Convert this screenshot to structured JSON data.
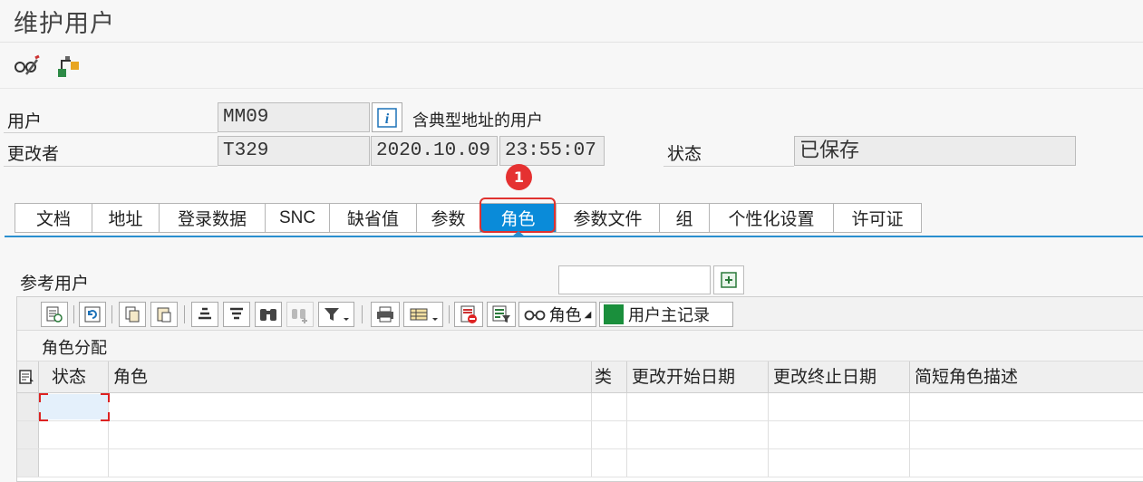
{
  "window": {
    "title": "维护用户"
  },
  "toolbar": {
    "icons": [
      "glasses-pen-icon",
      "hierarchy-icon"
    ]
  },
  "header": {
    "user_label": "用户",
    "user_value": "MM09",
    "user_desc": "含典型地址的用户",
    "changed_by_label": "更改者",
    "changed_by_value": "T329",
    "date": "2020.10.09",
    "time": "23:55:07",
    "status_label": "状态",
    "status_value": "已保存"
  },
  "tabs": [
    {
      "label": "文档"
    },
    {
      "label": "地址"
    },
    {
      "label": "登录数据"
    },
    {
      "label": "SNC"
    },
    {
      "label": "缺省值"
    },
    {
      "label": "参数"
    },
    {
      "label": "角色",
      "selected": true
    },
    {
      "label": "参数文件"
    },
    {
      "label": "组"
    },
    {
      "label": "个性化设置"
    },
    {
      "label": "许可证"
    }
  ],
  "annotation": {
    "badge": "1"
  },
  "role_tab": {
    "ref_user_label": "参考用户",
    "ref_user_value": "",
    "alv_toolbar": {
      "roles_label": "角色",
      "user_master_label": "用户主记录"
    },
    "table_title": "角色分配",
    "columns": [
      "状态",
      "角色",
      "类",
      "更改开始日期",
      "更改终止日期",
      "简短角色描述"
    ],
    "rows": [
      [
        "",
        "",
        "",
        "",
        "",
        ""
      ],
      [
        "",
        "",
        "",
        "",
        "",
        ""
      ],
      [
        "",
        "",
        "",
        "",
        "",
        ""
      ]
    ]
  },
  "colors": {
    "accent": "#0a8bd9",
    "highlight": "#e0322f",
    "user_master_green": "#1a8f3c"
  }
}
